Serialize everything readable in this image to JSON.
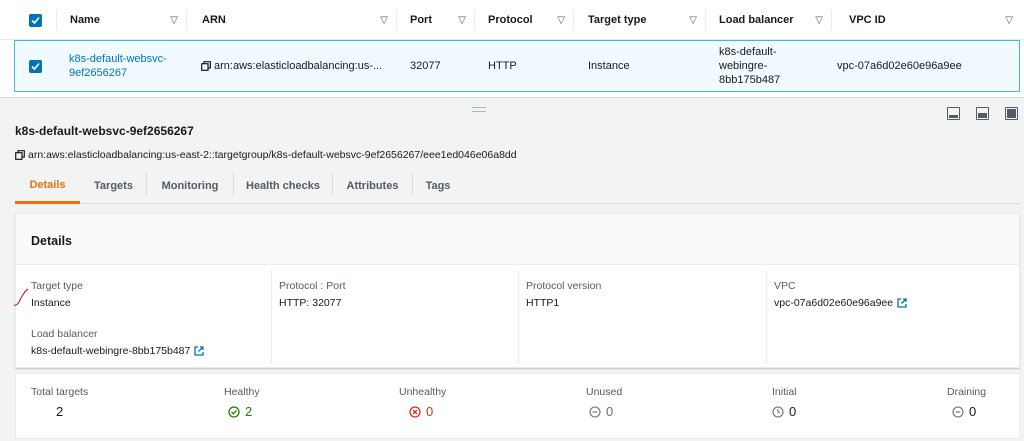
{
  "table": {
    "columns": [
      "Name",
      "ARN",
      "Port",
      "Protocol",
      "Target type",
      "Load balancer",
      "VPC ID"
    ],
    "row": {
      "name_line1": "k8s-default-websvc-",
      "name_line2": "9ef2656267",
      "arn": "arn:aws:elasticloadbalancing:us-...",
      "port": "32077",
      "protocol": "HTTP",
      "target_type": "Instance",
      "lb_line1": "k8s-default-",
      "lb_line2": "webingre-",
      "lb_line3": "8bb175b487",
      "vpc": "vpc-07a6d02e60e96a9ee"
    }
  },
  "detail": {
    "title": "k8s-default-websvc-9ef2656267",
    "arn": "arn:aws:elasticloadbalancing:us-east-2::targetgroup/k8s-default-websvc-9ef2656267/eee1ed046e06a8dd",
    "tabs": [
      "Details",
      "Targets",
      "Monitoring",
      "Health checks",
      "Attributes",
      "Tags"
    ],
    "active_tab": "Details",
    "card_title": "Details",
    "fields": {
      "target_type_label": "Target type",
      "target_type_value": "Instance",
      "protocol_port_label": "Protocol : Port",
      "protocol_port_value": "HTTP: 32077",
      "protocol_version_label": "Protocol version",
      "protocol_version_value": "HTTP1",
      "vpc_label": "VPC",
      "vpc_value": "vpc-07a6d02e60e96a9ee",
      "lb_label": "Load balancer",
      "lb_value": "k8s-default-webingre-8bb175b487"
    },
    "totals": {
      "total_label": "Total targets",
      "total_value": "2",
      "healthy_label": "Healthy",
      "healthy_value": "2",
      "unhealthy_label": "Unhealthy",
      "unhealthy_value": "0",
      "unused_label": "Unused",
      "unused_value": "0",
      "initial_label": "Initial",
      "initial_value": "0",
      "draining_label": "Draining",
      "draining_value": "0"
    }
  },
  "colors": {
    "link": "#0073bb",
    "active_tab": "#ec7211",
    "healthy": "#1d8102",
    "unhealthy": "#d13212",
    "neutral": "#687078",
    "selected_row_bg": "#f1faff",
    "selected_row_border": "#44b9d6"
  },
  "icons": {
    "copy": "copy-icon",
    "external": "external-link-icon",
    "sort": "sort-caret-icon",
    "healthy": "check-circle-icon",
    "unhealthy": "x-circle-icon",
    "unused": "minus-circle-icon",
    "initial": "clock-icon",
    "draining": "minus-circle-icon"
  }
}
